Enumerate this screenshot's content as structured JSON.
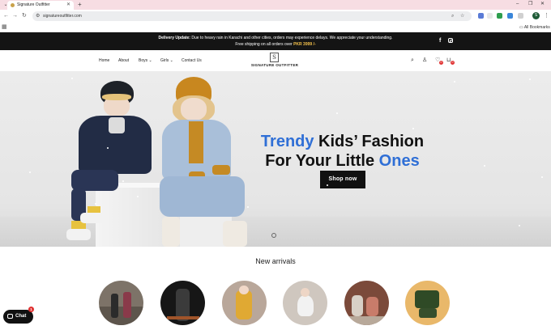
{
  "browser": {
    "tab_title": "Signature Outfitter",
    "url": "signatureoutfitter.com",
    "all_bookmarks": "All Bookmarks",
    "profile_initial": "S",
    "icons": [
      "tab-search-icon",
      "back-icon",
      "forward-icon",
      "reload-icon",
      "site-info-icon",
      "zoom-icon",
      "star-icon",
      "extension-icon",
      "minimize-icon",
      "maximize-icon",
      "close-icon",
      "apps-icon",
      "folder-icon"
    ]
  },
  "announcement": {
    "line1_bold": "Delivery Update:",
    "line1": " Due to heavy rain in Karachi and other cities, orders may experience delays. We appreciate your understanding.",
    "line2": "Free shipping on all orders over ",
    "line2_price": "PKR 3999 /-",
    "social": [
      "facebook-icon",
      "instagram-icon"
    ]
  },
  "header": {
    "nav": [
      {
        "label": "Home"
      },
      {
        "label": "About"
      },
      {
        "label": "Boys"
      },
      {
        "label": "Girls"
      },
      {
        "label": "Contact Us"
      }
    ],
    "logo_mark": "S",
    "logo_text": "SIGNATURE OUTFITTER",
    "wishlist_count": "0",
    "cart_count": "0"
  },
  "hero": {
    "line1_accent": "Trendy",
    "line1_rest": " Kids’ Fashion",
    "line2_start": "For Your Little ",
    "line2_accent": "Ones",
    "cta": "Shop now"
  },
  "new_arrivals": {
    "title": "New arrivals",
    "items": 6
  },
  "chat": {
    "label": "Chat",
    "badge": "1"
  },
  "colors": {
    "accent": "#2f6fd6",
    "announcement_bg": "#141414",
    "price_highlight": "#f3c04b",
    "badge": "#e03131",
    "tab_strip": "#f7dde3"
  }
}
